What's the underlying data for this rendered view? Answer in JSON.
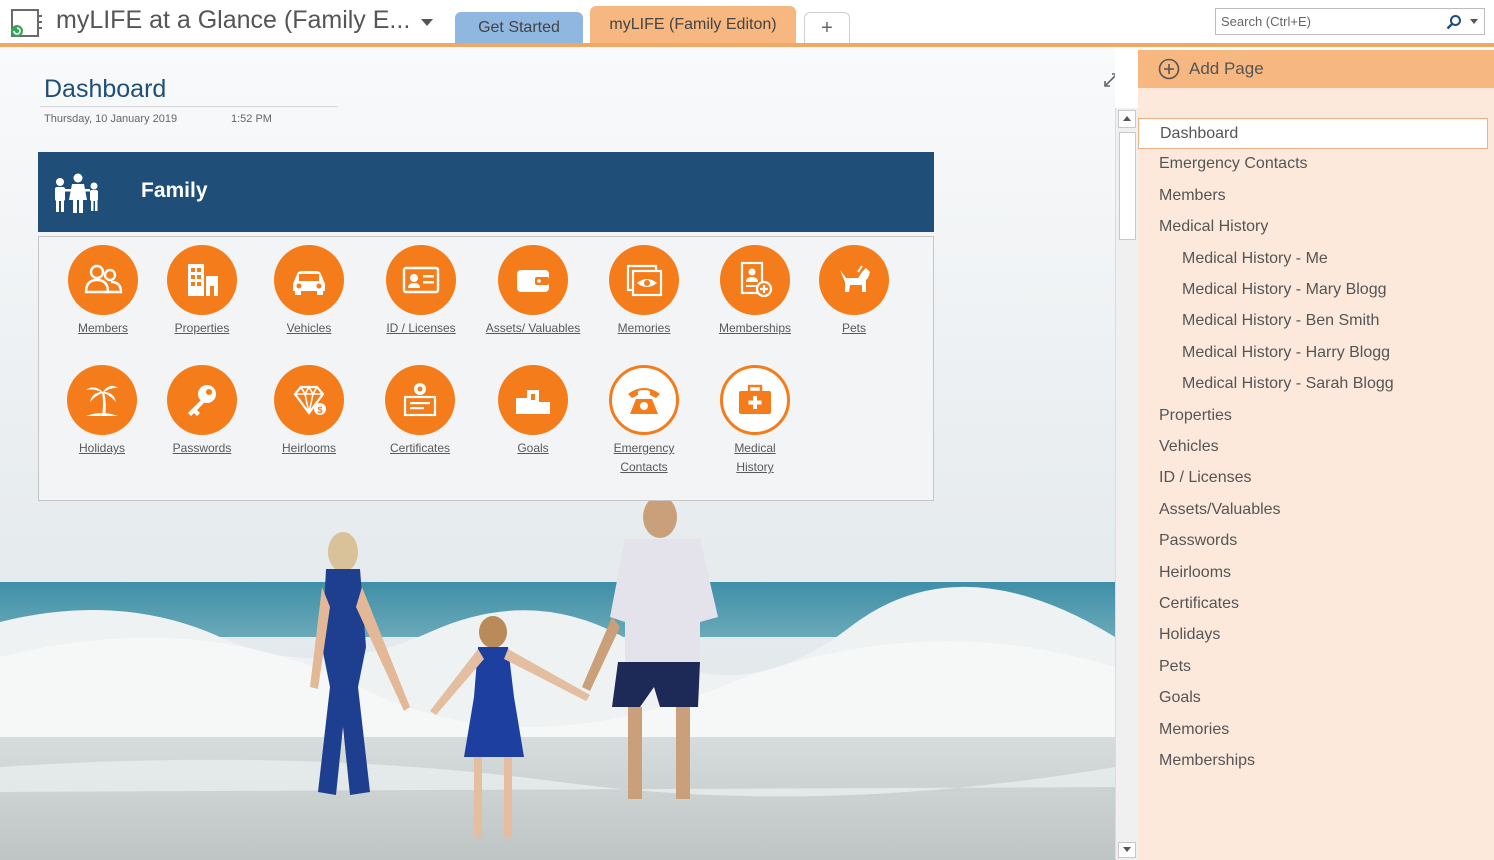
{
  "titlebar": {
    "notebook_title": "myLIFE at a Glance (Family E...",
    "tabs": [
      {
        "label": "Get Started"
      },
      {
        "label": "myLIFE (Family Editon)"
      },
      {
        "label": "+"
      }
    ],
    "search_placeholder": "Search (Ctrl+E)"
  },
  "page": {
    "title": "Dashboard",
    "date": "Thursday, 10 January 2019",
    "time": "1:52 PM"
  },
  "section": {
    "title": "Family"
  },
  "tiles": [
    {
      "label": "Members",
      "icon": "members-icon"
    },
    {
      "label": "Properties",
      "icon": "properties-icon"
    },
    {
      "label": "Vehicles",
      "icon": "vehicle-icon"
    },
    {
      "label": "ID / Licenses",
      "icon": "id-card-icon"
    },
    {
      "label": "Assets/ Valuables",
      "icon": "wallet-icon"
    },
    {
      "label": "Memories",
      "icon": "photo-eye-icon"
    },
    {
      "label": "Memberships",
      "icon": "membership-card-icon"
    },
    {
      "label": "Pets",
      "icon": "dog-icon"
    },
    {
      "label": "Holidays",
      "icon": "palm-tree-icon"
    },
    {
      "label": "Passwords",
      "icon": "key-icon"
    },
    {
      "label": "Heirlooms",
      "icon": "diamond-icon"
    },
    {
      "label": "Certificates",
      "icon": "certificate-icon"
    },
    {
      "label": "Goals",
      "icon": "podium-icon"
    },
    {
      "label": "Emergency",
      "label2": "Contacts",
      "icon": "phone-icon"
    },
    {
      "label": "Medical",
      "label2": "History",
      "icon": "medical-kit-icon"
    }
  ],
  "pages_pane": {
    "add_page_label": "Add Page",
    "pages": [
      {
        "label": "Dashboard",
        "selected": true
      },
      {
        "label": "Emergency Contacts"
      },
      {
        "label": "Members"
      },
      {
        "label": "Medical History"
      },
      {
        "label": "Medical History - Me",
        "indent": 1
      },
      {
        "label": "Medical History - Mary Blogg",
        "indent": 1
      },
      {
        "label": "Medical History - Ben Smith",
        "indent": 1
      },
      {
        "label": "Medical History - Harry Blogg",
        "indent": 1
      },
      {
        "label": "Medical History - Sarah Blogg",
        "indent": 1
      },
      {
        "label": "Properties"
      },
      {
        "label": "Vehicles"
      },
      {
        "label": "ID / Licenses"
      },
      {
        "label": "Assets/Valuables"
      },
      {
        "label": "Passwords"
      },
      {
        "label": "Heirlooms"
      },
      {
        "label": "Certificates"
      },
      {
        "label": "Holidays"
      },
      {
        "label": "Pets"
      },
      {
        "label": "Goals"
      },
      {
        "label": "Memories"
      },
      {
        "label": "Memberships"
      }
    ]
  },
  "colors": {
    "accent_orange": "#f47c1a",
    "tab_orange": "#f7b781",
    "tab_blue": "#8fb7e0",
    "section_navy": "#1f4e79",
    "pane_peach": "#fde9dc"
  }
}
